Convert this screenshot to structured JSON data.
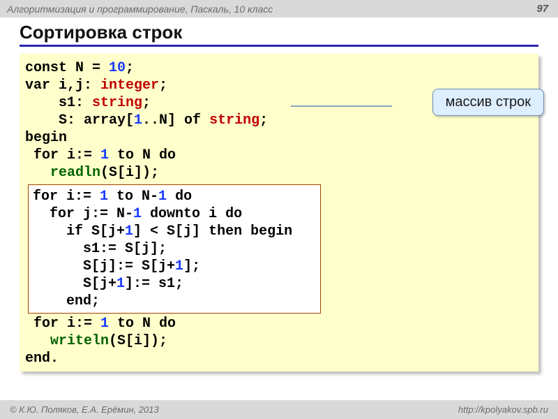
{
  "header": {
    "course": "Алгоритмизация и программирование, Паскаль, 10 класс",
    "page": "97"
  },
  "title": "Сортировка строк",
  "code": {
    "l1": {
      "a": "const N",
      "eq": " = ",
      "val": "10",
      "end": ";"
    },
    "l2": {
      "a": "var i,j: ",
      "t": "integer",
      "end": ";"
    },
    "l3": {
      "a": "    s1: ",
      "t": "string",
      "end": ";"
    },
    "l4": {
      "a": "    S: array[",
      "one": "1",
      "b": "..N] of ",
      "t": "string",
      "end": ";"
    },
    "l5": "begin",
    "l6": {
      "a": " for i:= ",
      "one": "1",
      "b": " to N do"
    },
    "l7": {
      "a": "   ",
      "fn": "readln",
      "b": "(S[i]);"
    },
    "inner": {
      "i1": {
        "a": "for i:= ",
        "one": "1",
        "b": " to N-",
        "one2": "1",
        "c": " do"
      },
      "i2": {
        "a": "  for j:= N-",
        "one": "1",
        "b": " downto i do"
      },
      "i3": {
        "a": "    if S[j+",
        "one": "1",
        "b": "] < S[j] then begin"
      },
      "i4": "      s1:= S[j];",
      "i5": {
        "a": "      S[j]:= S[j+",
        "one": "1",
        "b": "];"
      },
      "i6": {
        "a": "      S[j+",
        "one": "1",
        "b": "]:= s1;"
      },
      "i7": "    end;"
    },
    "l8": {
      "a": " for i:= ",
      "one": "1",
      "b": " to N do"
    },
    "l9": {
      "a": "   ",
      "fn": "writeln",
      "b": "(S[i]);"
    },
    "l10": "end."
  },
  "callout": "массив строк",
  "footer": {
    "left": "© К.Ю. Поляков, Е.А. Ерёмин, 2013",
    "right": "http://kpolyakov.spb.ru"
  }
}
